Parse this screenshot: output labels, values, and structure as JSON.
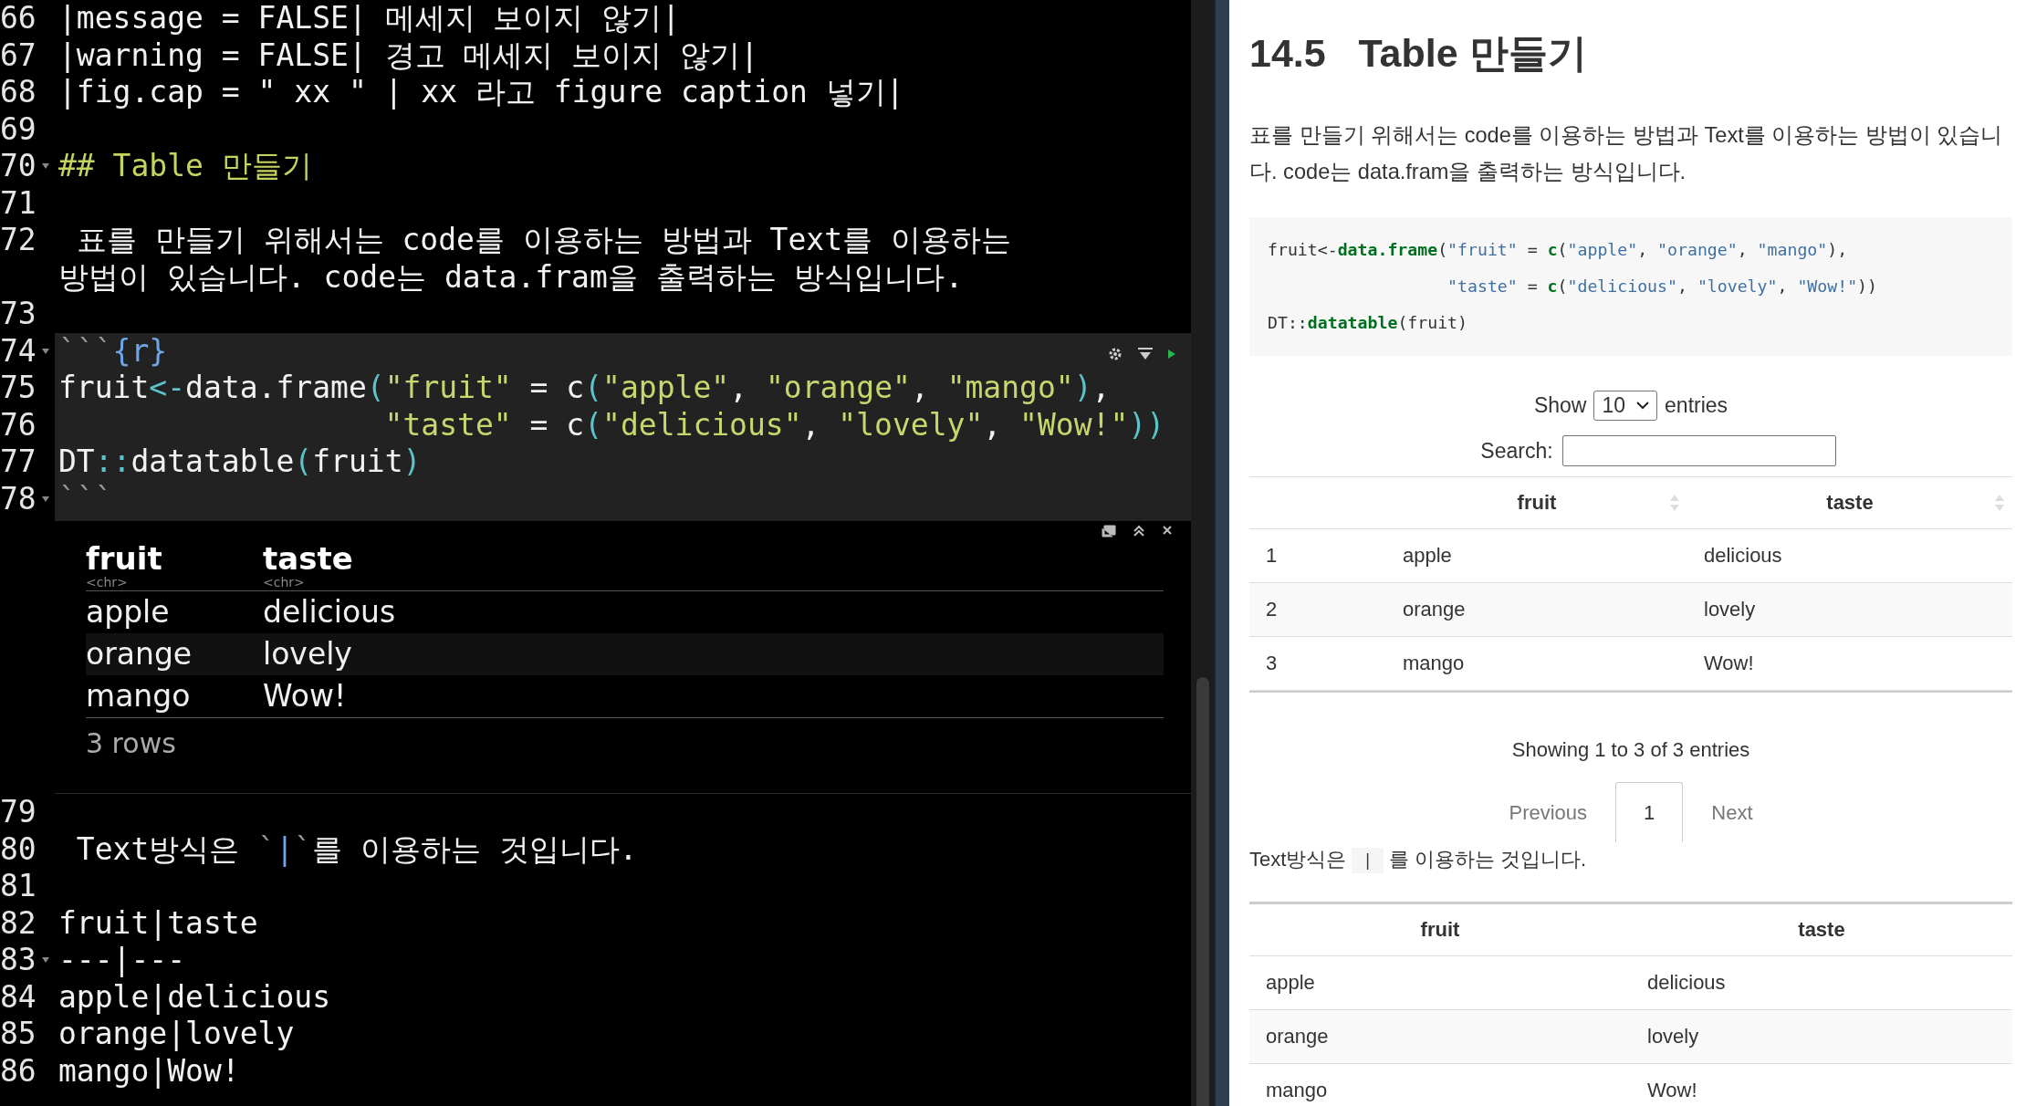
{
  "editor": {
    "lines": [
      {
        "number": "66",
        "fold": false,
        "kind": "prose",
        "segments": [
          {
            "kind": "plain",
            "text": "|message = FALSE| 메세지 보이지 않기|"
          }
        ]
      },
      {
        "number": "67",
        "fold": false,
        "kind": "prose",
        "segments": [
          {
            "kind": "plain",
            "text": "|warning = FALSE| 경고 메세지 보이지 않기|"
          }
        ]
      },
      {
        "number": "68",
        "fold": false,
        "kind": "prose",
        "segments": [
          {
            "kind": "plain",
            "text": "|fig.cap = \" xx \" | xx 라고 figure caption 넣기|"
          }
        ]
      },
      {
        "number": "69",
        "fold": false,
        "kind": "blank"
      },
      {
        "number": "70",
        "fold": true,
        "kind": "prose",
        "segments": [
          {
            "kind": "heading",
            "text": "## Table 만들기"
          }
        ]
      },
      {
        "number": "71",
        "fold": false,
        "kind": "blank"
      },
      {
        "number": "72",
        "fold": false,
        "kind": "prose",
        "segments": [
          {
            "kind": "plain",
            "text": " 표를 만들기 위해서는 code를 이용하는 방법과 Text를 이용하는"
          }
        ],
        "continued": "방법이 있습니다. code는 data.fram을 출력하는 방식입니다."
      },
      {
        "number": "73",
        "fold": false,
        "kind": "blank"
      },
      {
        "number": "74",
        "fold": true,
        "kind": "fence",
        "tools": true,
        "segments": [
          {
            "kind": "tick",
            "text": "```"
          },
          {
            "kind": "option",
            "text": "{r}"
          }
        ]
      },
      {
        "number": "75",
        "fold": false,
        "kind": "code",
        "segments": [
          {
            "kind": "plain",
            "text": "fruit"
          },
          {
            "kind": "op",
            "text": "<-"
          },
          {
            "kind": "plain",
            "text": "data.frame"
          },
          {
            "kind": "op",
            "text": "("
          },
          {
            "kind": "string",
            "text": "\"fruit\""
          },
          {
            "kind": "plain",
            "text": " = c"
          },
          {
            "kind": "op",
            "text": "("
          },
          {
            "kind": "string",
            "text": "\"apple\""
          },
          {
            "kind": "plain",
            "text": ", "
          },
          {
            "kind": "string",
            "text": "\"orange\""
          },
          {
            "kind": "plain",
            "text": ", "
          },
          {
            "kind": "string",
            "text": "\"mango\""
          },
          {
            "kind": "op",
            "text": ")"
          },
          {
            "kind": "plain",
            "text": ","
          }
        ]
      },
      {
        "number": "76",
        "fold": false,
        "kind": "code",
        "indent": true,
        "segments": [
          {
            "kind": "string",
            "text": "\"taste\""
          },
          {
            "kind": "plain",
            "text": " = c"
          },
          {
            "kind": "op",
            "text": "("
          },
          {
            "kind": "string",
            "text": "\"delicious\""
          },
          {
            "kind": "plain",
            "text": ", "
          },
          {
            "kind": "string",
            "text": "\"lovely\""
          },
          {
            "kind": "plain",
            "text": ", "
          },
          {
            "kind": "string",
            "text": "\"Wow!\""
          },
          {
            "kind": "op",
            "text": "))"
          }
        ]
      },
      {
        "number": "77",
        "fold": false,
        "kind": "code",
        "segments": [
          {
            "kind": "plain",
            "text": "DT"
          },
          {
            "kind": "op",
            "text": "::"
          },
          {
            "kind": "plain",
            "text": "datatable"
          },
          {
            "kind": "op",
            "text": "("
          },
          {
            "kind": "plain",
            "text": "fruit"
          },
          {
            "kind": "op",
            "text": ")"
          }
        ]
      },
      {
        "number": "78",
        "fold": true,
        "kind": "fence",
        "output": true,
        "segments": [
          {
            "kind": "tick",
            "text": "```"
          }
        ]
      },
      {
        "number": "79",
        "fold": false,
        "kind": "blank"
      },
      {
        "number": "80",
        "fold": false,
        "kind": "prose",
        "segments": [
          {
            "kind": "plain",
            "text": " Text방식은 "
          },
          {
            "kind": "tick",
            "text": "`"
          },
          {
            "kind": "option",
            "text": "|"
          },
          {
            "kind": "tick",
            "text": "`"
          },
          {
            "kind": "plain",
            "text": "를 이용하는 것입니다."
          }
        ]
      },
      {
        "number": "81",
        "fold": false,
        "kind": "blank"
      },
      {
        "number": "82",
        "fold": false,
        "kind": "prose",
        "segments": [
          {
            "kind": "plain",
            "text": "fruit|taste"
          }
        ]
      },
      {
        "number": "83",
        "fold": true,
        "kind": "prose",
        "segments": [
          {
            "kind": "plain",
            "text": "---|---"
          }
        ]
      },
      {
        "number": "84",
        "fold": false,
        "kind": "prose",
        "segments": [
          {
            "kind": "plain",
            "text": "apple|delicious"
          }
        ]
      },
      {
        "number": "85",
        "fold": false,
        "kind": "prose",
        "segments": [
          {
            "kind": "plain",
            "text": "orange|lovely"
          }
        ]
      },
      {
        "number": "86",
        "fold": false,
        "kind": "prose",
        "segments": [
          {
            "kind": "plain",
            "text": "mango|Wow!"
          }
        ]
      }
    ],
    "output": {
      "columns": [
        {
          "name": "fruit",
          "type": "<chr>"
        },
        {
          "name": "taste",
          "type": "<chr>"
        }
      ],
      "rows": [
        [
          "apple",
          "delicious"
        ],
        [
          "orange",
          "lovely"
        ],
        [
          "mango",
          "Wow!"
        ]
      ],
      "footer": "3 rows"
    }
  },
  "preview": {
    "number": "14.5",
    "title": "Table 만들기",
    "paragraph": "표를 만들기 위해서는 code를 이용하는 방법과 Text를 이용하는 방법이 있습니다. code는 data.fram을 출력하는 방식입니다.",
    "code_indent": [
      false,
      true,
      false
    ],
    "code": [
      [
        {
          "kind": "plain",
          "text": "fruit<-"
        },
        {
          "kind": "fn",
          "text": "data.frame"
        },
        {
          "kind": "plain",
          "text": "("
        },
        {
          "kind": "string",
          "text": "\"fruit\""
        },
        {
          "kind": "plain",
          "text": " = "
        },
        {
          "kind": "fn",
          "text": "c"
        },
        {
          "kind": "plain",
          "text": "("
        },
        {
          "kind": "string",
          "text": "\"apple\""
        },
        {
          "kind": "plain",
          "text": ", "
        },
        {
          "kind": "string",
          "text": "\"orange\""
        },
        {
          "kind": "plain",
          "text": ", "
        },
        {
          "kind": "string",
          "text": "\"mango\""
        },
        {
          "kind": "plain",
          "text": "),"
        }
      ],
      [
        {
          "kind": "string",
          "text": "\"taste\""
        },
        {
          "kind": "plain",
          "text": " = "
        },
        {
          "kind": "fn",
          "text": "c"
        },
        {
          "kind": "plain",
          "text": "("
        },
        {
          "kind": "string",
          "text": "\"delicious\""
        },
        {
          "kind": "plain",
          "text": ", "
        },
        {
          "kind": "string",
          "text": "\"lovely\""
        },
        {
          "kind": "plain",
          "text": ", "
        },
        {
          "kind": "string",
          "text": "\"Wow!\""
        },
        {
          "kind": "plain",
          "text": "))"
        }
      ],
      [
        {
          "kind": "plain",
          "text": "DT::"
        },
        {
          "kind": "fn",
          "text": "datatable"
        },
        {
          "kind": "plain",
          "text": "(fruit)"
        }
      ]
    ],
    "datatable": {
      "show_label": "Show",
      "length": "10",
      "entries_label": "entries",
      "search_label": "Search:",
      "columns": [
        {
          "label": "fruit"
        },
        {
          "label": "taste"
        }
      ],
      "rows": [
        {
          "index": "1",
          "cells": [
            "apple",
            "delicious"
          ]
        },
        {
          "index": "2",
          "cells": [
            "orange",
            "lovely"
          ]
        },
        {
          "index": "3",
          "cells": [
            "mango",
            "Wow!"
          ]
        }
      ],
      "info": "Showing 1 to 3 of 3 entries",
      "pages": [
        {
          "label": "Previous",
          "selected": false,
          "disabled": true
        },
        {
          "label": "1",
          "selected": true,
          "disabled": false
        },
        {
          "label": "Next",
          "selected": false,
          "disabled": true
        }
      ]
    },
    "text_method": {
      "before": "Text방식은",
      "code": "|",
      "after": "를 이용하는 것입니다."
    },
    "markdown_table": {
      "columns": [
        "fruit",
        "taste"
      ],
      "rows": [
        [
          "apple",
          "delicious"
        ],
        [
          "orange",
          "lovely"
        ],
        [
          "mango",
          "Wow!"
        ]
      ]
    }
  }
}
